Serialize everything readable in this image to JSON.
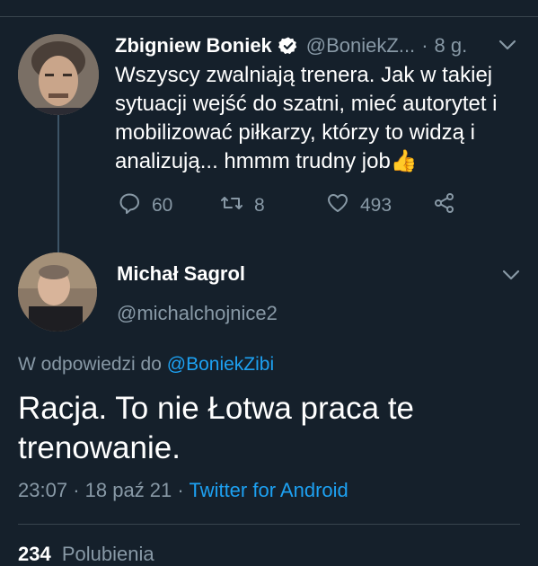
{
  "tweet": {
    "author_name": "Zbigniew Boniek",
    "handle": "@BoniekZ...",
    "separator": "·",
    "time": "8 g.",
    "text": "Wszyscy zwalniają trenera. Jak w takiej\nsytuacji wejść do szatni, mieć autorytet i\nmobilizować piłkarzy, którzy to widzą i\nanalizują... hmmm trudny job👍",
    "replies": "60",
    "retweets": "8",
    "likes": "493"
  },
  "reply": {
    "author_name": "Michał Sagrol",
    "handle": "@michalchojnice2",
    "reply_to_prefix": "W odpowiedzi do",
    "reply_to_handle": "@BoniekZibi",
    "text": "Racja. To nie Łotwa praca te\ntrenowanie.",
    "time": "23:07",
    "date": "18 paź 21",
    "separator": "·",
    "source": "Twitter for Android",
    "likes_count": "234",
    "likes_label": "Polubienia"
  },
  "colors": {
    "background": "#15202b",
    "secondary_text": "#8899a6",
    "accent": "#1da1f2",
    "divider": "#38444d"
  },
  "icons": [
    "verified-icon",
    "chevron-down-icon",
    "reply-icon",
    "retweet-icon",
    "like-icon",
    "share-icon"
  ]
}
